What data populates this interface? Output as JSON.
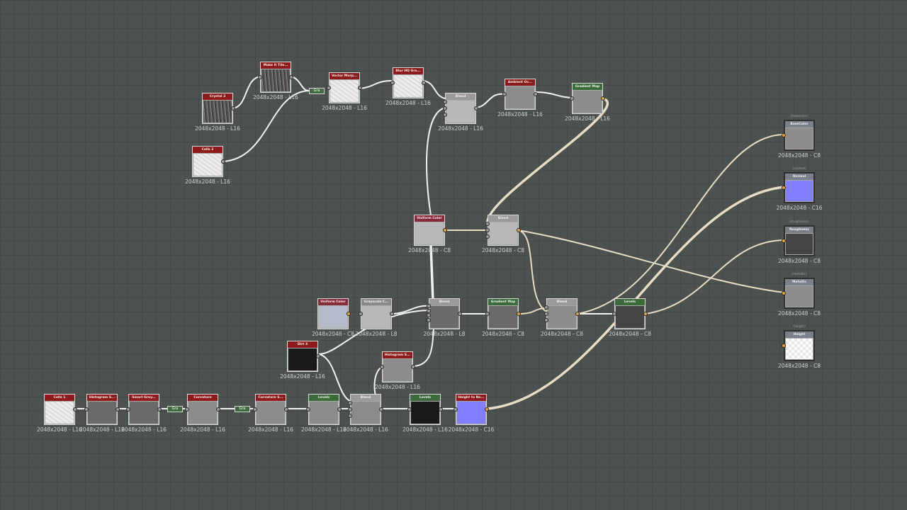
{
  "graph": {
    "nodes": [
      {
        "id": "crystal2",
        "title": "Crystal 2",
        "res": "2048x2048 - L16",
        "hdr": "#8e1a1a",
        "thumb": "noise-dark"
      },
      {
        "id": "makeit",
        "title": "Make It Tile...",
        "res": "2048x2048 - L16",
        "hdr": "#8e1a1a",
        "thumb": "noise-dark"
      },
      {
        "id": "cells2",
        "title": "Cells 2",
        "res": "2048x2048 - L16",
        "hdr": "#8e1a1a",
        "thumb": "noise-light"
      },
      {
        "id": "vector",
        "title": "Vector Morp...",
        "res": "2048x2048 - L16",
        "hdr": "#8e1a1a",
        "thumb": "noise-light"
      },
      {
        "id": "blurhq",
        "title": "Blur HQ Gra...",
        "res": "2048x2048 - L16",
        "hdr": "#8e1a1a",
        "thumb": "noise-light"
      },
      {
        "id": "blend1",
        "title": "Blend",
        "res": "2048x2048 - L16",
        "hdr": "#9a9a9a",
        "thumb": "grey-light"
      },
      {
        "id": "ambient",
        "title": "Ambient Oc...",
        "res": "2048x2048 - L16",
        "hdr": "#8e1a1a",
        "thumb": "grey-mid"
      },
      {
        "id": "gmap1",
        "title": "Gradient Map",
        "res": "2048x2048 - L16",
        "hdr": "#3a6b38",
        "thumb": "grey-mid"
      },
      {
        "id": "ucolor1",
        "title": "Uniform Color",
        "res": "2048x2048 - C8",
        "hdr": "#8a2b3a",
        "thumb": "grey-light"
      },
      {
        "id": "blend2",
        "title": "Blend",
        "res": "2048x2048 - C8",
        "hdr": "#9a9a9a",
        "thumb": "grey-light"
      },
      {
        "id": "ucolor2",
        "title": "Uniform Color",
        "res": "2048x2048 - C8",
        "hdr": "#8a2b3a",
        "thumb": "blue-grey"
      },
      {
        "id": "grayscale",
        "title": "Grayscale C...",
        "res": "2048x2048 - L8",
        "hdr": "#8a8a8a",
        "thumb": "grey-light"
      },
      {
        "id": "blend3",
        "title": "Blend",
        "res": "2048x2048 - L8",
        "hdr": "#9a9a9a",
        "thumb": "grey-dark"
      },
      {
        "id": "gmap2",
        "title": "Gradient Map",
        "res": "2048x2048 - C8",
        "hdr": "#3a6b38",
        "thumb": "grey-dark"
      },
      {
        "id": "blend4",
        "title": "Blend",
        "res": "2048x2048 - C8",
        "hdr": "#9a9a9a",
        "thumb": "grey-mid"
      },
      {
        "id": "levels1",
        "title": "Levels",
        "res": "2048x2048 - C8",
        "hdr": "#3a6b38",
        "thumb": "grey-darker"
      },
      {
        "id": "dirt3",
        "title": "Dirt 3",
        "res": "2048x2048 - L16",
        "hdr": "#8e1a1a",
        "thumb": "black"
      },
      {
        "id": "histo2",
        "title": "Histogram S...",
        "res": "2048x2048 - L16",
        "hdr": "#8e1a1a",
        "thumb": "grey-mid"
      },
      {
        "id": "cells1",
        "title": "Cells 1",
        "res": "2048x2048 - L16",
        "hdr": "#8e1a1a",
        "thumb": "noise-light"
      },
      {
        "id": "histo1",
        "title": "Histogram S...",
        "res": "2048x2048 - L16",
        "hdr": "#8e1a1a",
        "thumb": "grey-dark"
      },
      {
        "id": "smartgrey",
        "title": "Smart Grey...",
        "res": "2048x2048 - L16",
        "hdr": "#8e1a1a",
        "thumb": "grey-dark"
      },
      {
        "id": "curvature",
        "title": "Curvature",
        "res": "2048x2048 - L16",
        "hdr": "#8e1a1a",
        "thumb": "grey-mid"
      },
      {
        "id": "curvatures",
        "title": "Curvature S...",
        "res": "2048x2048 - L16",
        "hdr": "#8e1a1a",
        "thumb": "grey-mid"
      },
      {
        "id": "levels2",
        "title": "Levels",
        "res": "2048x2048 - L16",
        "hdr": "#3a6b38",
        "thumb": "grey-mid"
      },
      {
        "id": "blend5",
        "title": "Blend",
        "res": "2048x2048 - L16",
        "hdr": "#9a9a9a",
        "thumb": "grey-mid"
      },
      {
        "id": "levels3",
        "title": "Levels",
        "res": "2048x2048 - L16",
        "hdr": "#3a6b38",
        "thumb": "black"
      },
      {
        "id": "heighttonormal",
        "title": "Height to No...",
        "res": "2048x2048 - C16",
        "hdr": "#8e1a1a",
        "thumb": "normal"
      }
    ],
    "outputs": [
      {
        "id": "basecolor",
        "tag": "(basecolor)",
        "title": "BaseColor",
        "res": "2048x2048 - C8",
        "thumb": "grey-mid"
      },
      {
        "id": "normal",
        "tag": "(normal)",
        "title": "Normal",
        "res": "2048x2048 - C16",
        "thumb": "normal"
      },
      {
        "id": "roughness",
        "tag": "(roughness)",
        "title": "Roughness",
        "res": "2048x2048 - C8",
        "thumb": "grey-darker"
      },
      {
        "id": "metallic",
        "tag": "(metallic)",
        "title": "Metallic",
        "res": "2048x2048 - C8",
        "thumb": "grey-mid"
      },
      {
        "id": "height",
        "tag": "(height)",
        "title": "Height",
        "res": "2048x2048 - C8",
        "thumb": "checker"
      }
    ],
    "gradient_chips": [
      "Gra",
      "Gra",
      "Gra"
    ]
  }
}
